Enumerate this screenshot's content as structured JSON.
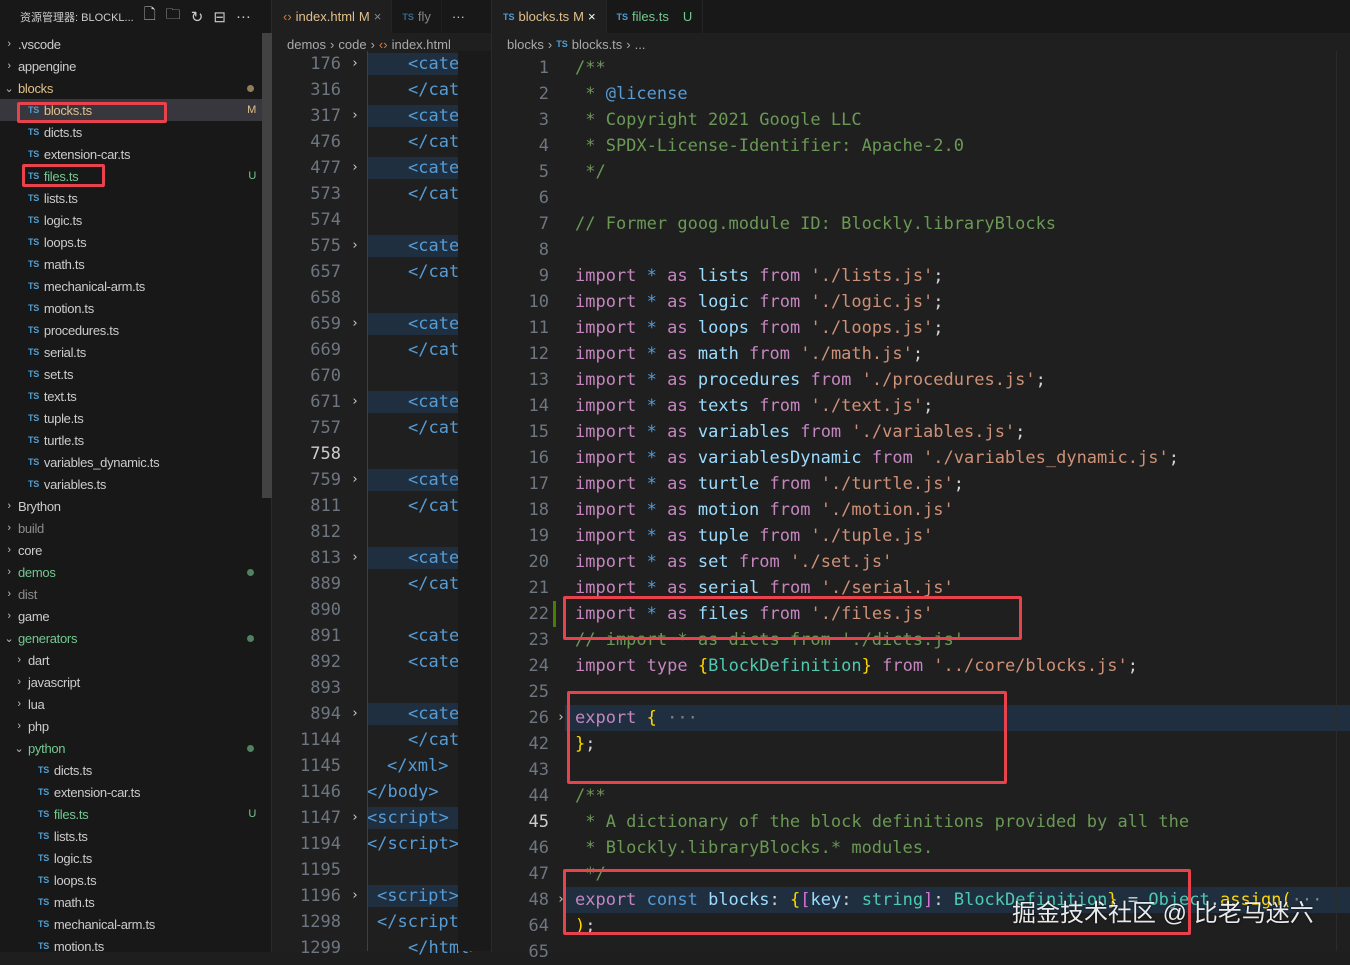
{
  "sidebar": {
    "title": "资源管理器: BLOCKL...",
    "actions": [
      "new-file",
      "new-folder",
      "refresh",
      "collapse-all",
      "more"
    ],
    "items": [
      {
        "label": ".vscode",
        "kind": "folder",
        "depth": 0
      },
      {
        "label": "appengine",
        "kind": "folder",
        "depth": 0
      },
      {
        "label": "blocks",
        "kind": "open",
        "depth": 0,
        "color": "#e2c08d",
        "dot": true
      },
      {
        "label": "blocks.ts",
        "kind": "ts",
        "depth": 1,
        "color": "#e2c08d",
        "badge": "M",
        "selected": true
      },
      {
        "label": "dicts.ts",
        "kind": "ts",
        "depth": 1
      },
      {
        "label": "extension-car.ts",
        "kind": "ts",
        "depth": 1
      },
      {
        "label": "files.ts",
        "kind": "ts",
        "depth": 1,
        "color": "#73c991",
        "badge": "U"
      },
      {
        "label": "lists.ts",
        "kind": "ts",
        "depth": 1
      },
      {
        "label": "logic.ts",
        "kind": "ts",
        "depth": 1
      },
      {
        "label": "loops.ts",
        "kind": "ts",
        "depth": 1
      },
      {
        "label": "math.ts",
        "kind": "ts",
        "depth": 1
      },
      {
        "label": "mechanical-arm.ts",
        "kind": "ts",
        "depth": 1
      },
      {
        "label": "motion.ts",
        "kind": "ts",
        "depth": 1
      },
      {
        "label": "procedures.ts",
        "kind": "ts",
        "depth": 1
      },
      {
        "label": "serial.ts",
        "kind": "ts",
        "depth": 1
      },
      {
        "label": "set.ts",
        "kind": "ts",
        "depth": 1
      },
      {
        "label": "text.ts",
        "kind": "ts",
        "depth": 1
      },
      {
        "label": "tuple.ts",
        "kind": "ts",
        "depth": 1
      },
      {
        "label": "turtle.ts",
        "kind": "ts",
        "depth": 1
      },
      {
        "label": "variables_dynamic.ts",
        "kind": "ts",
        "depth": 1
      },
      {
        "label": "variables.ts",
        "kind": "ts",
        "depth": 1
      },
      {
        "label": "Brython",
        "kind": "folder",
        "depth": 0
      },
      {
        "label": "build",
        "kind": "folder",
        "depth": 0,
        "color": "#8c8c8c"
      },
      {
        "label": "core",
        "kind": "folder",
        "depth": 0
      },
      {
        "label": "demos",
        "kind": "folder",
        "depth": 0,
        "color": "#73c991",
        "dot": true
      },
      {
        "label": "dist",
        "kind": "folder",
        "depth": 0,
        "color": "#8c8c8c"
      },
      {
        "label": "game",
        "kind": "folder",
        "depth": 0
      },
      {
        "label": "generators",
        "kind": "open",
        "depth": 0,
        "color": "#73c991",
        "dot": true
      },
      {
        "label": "dart",
        "kind": "folder",
        "depth": 1
      },
      {
        "label": "javascript",
        "kind": "folder",
        "depth": 1
      },
      {
        "label": "lua",
        "kind": "folder",
        "depth": 1
      },
      {
        "label": "php",
        "kind": "folder",
        "depth": 1
      },
      {
        "label": "python",
        "kind": "open",
        "depth": 1,
        "color": "#73c991",
        "dot": true
      },
      {
        "label": "dicts.ts",
        "kind": "ts",
        "depth": 2
      },
      {
        "label": "extension-car.ts",
        "kind": "ts",
        "depth": 2
      },
      {
        "label": "files.ts",
        "kind": "ts",
        "depth": 2,
        "color": "#73c991",
        "badge": "U"
      },
      {
        "label": "lists.ts",
        "kind": "ts",
        "depth": 2
      },
      {
        "label": "logic.ts",
        "kind": "ts",
        "depth": 2
      },
      {
        "label": "loops.ts",
        "kind": "ts",
        "depth": 2
      },
      {
        "label": "math.ts",
        "kind": "ts",
        "depth": 2
      },
      {
        "label": "mechanical-arm.ts",
        "kind": "ts",
        "depth": 2
      },
      {
        "label": "motion.ts",
        "kind": "ts",
        "depth": 2
      }
    ]
  },
  "editor_left": {
    "tabs": [
      {
        "label": "index.html",
        "badge": "M",
        "icon": "<>",
        "active": true
      },
      {
        "label": "fly",
        "icon": "TS"
      }
    ],
    "more": "···",
    "breadcrumb": [
      "demos",
      "code",
      "index.html"
    ],
    "lines": [
      [
        "176",
        true,
        "<cate",
        true
      ],
      [
        "316",
        false,
        "</cat",
        false
      ],
      [
        "317",
        true,
        "<cate",
        true
      ],
      [
        "476",
        false,
        "</cat",
        false
      ],
      [
        "477",
        true,
        "<cate",
        true
      ],
      [
        "573",
        false,
        "</cat",
        false
      ],
      [
        "574",
        false,
        "",
        false
      ],
      [
        "575",
        true,
        "<cate",
        true
      ],
      [
        "657",
        false,
        "</cat",
        false
      ],
      [
        "658",
        false,
        "",
        false
      ],
      [
        "659",
        true,
        "<cate",
        true
      ],
      [
        "669",
        false,
        "</cat",
        false
      ],
      [
        "670",
        false,
        "",
        false
      ],
      [
        "671",
        true,
        "<cate",
        true
      ],
      [
        "757",
        false,
        "</cat",
        false
      ],
      [
        "758",
        false,
        "",
        false
      ],
      [
        "759",
        true,
        "<cate",
        true
      ],
      [
        "811",
        false,
        "</cat",
        false
      ],
      [
        "812",
        false,
        "",
        false
      ],
      [
        "813",
        true,
        "<cate",
        true
      ],
      [
        "889",
        false,
        "</cat",
        false
      ],
      [
        "890",
        false,
        "",
        false
      ],
      [
        "891",
        false,
        "<cate",
        false
      ],
      [
        "892",
        false,
        "<cate",
        false
      ],
      [
        "893",
        false,
        "",
        false
      ],
      [
        "894",
        true,
        "<cate",
        true
      ],
      [
        "1144",
        false,
        "</cat",
        false
      ],
      [
        "1145",
        false,
        "</xml>",
        false
      ],
      [
        "1146",
        false,
        "</body>",
        false
      ],
      [
        "1147",
        true,
        "<script>",
        true
      ],
      [
        "1194",
        false,
        "</script>",
        false
      ],
      [
        "1195",
        false,
        "",
        false
      ],
      [
        "1196",
        true,
        "<script>",
        true
      ],
      [
        "1298",
        false,
        "</script",
        false
      ],
      [
        "1299",
        false,
        "</html>",
        false
      ]
    ],
    "current_line": "758"
  },
  "editor_right": {
    "tabs": [
      {
        "label": "blocks.ts",
        "badge": "M",
        "icon": "TS",
        "active": true,
        "close": "×"
      },
      {
        "label": "files.ts",
        "badge": "U",
        "icon": "TS"
      }
    ],
    "breadcrumb": [
      "blocks",
      "blocks.ts",
      "..."
    ],
    "current_line": "45",
    "lines": [
      [
        "1",
        [
          [
            "c",
            "/**"
          ]
        ]
      ],
      [
        "2",
        [
          [
            "c",
            " * "
          ],
          [
            "b",
            "@license"
          ]
        ]
      ],
      [
        "3",
        [
          [
            "c",
            " * Copyright 2021 Google LLC"
          ]
        ]
      ],
      [
        "4",
        [
          [
            "c",
            " * SPDX-License-Identifier: Apache-2.0"
          ]
        ]
      ],
      [
        "5",
        [
          [
            "c",
            " */"
          ]
        ]
      ],
      [
        "6",
        []
      ],
      [
        "7",
        [
          [
            "c",
            "// Former goog.module ID: Blockly.libraryBlocks"
          ]
        ]
      ],
      [
        "8",
        []
      ],
      [
        "9",
        [
          [
            "k",
            "import "
          ],
          [
            "b",
            "* "
          ],
          [
            "k",
            "as "
          ],
          [
            "v",
            "lists "
          ],
          [
            "k",
            "from "
          ],
          [
            "s",
            "'./lists.js'"
          ],
          [
            "p",
            ";"
          ]
        ]
      ],
      [
        "10",
        [
          [
            "k",
            "import "
          ],
          [
            "b",
            "* "
          ],
          [
            "k",
            "as "
          ],
          [
            "v",
            "logic "
          ],
          [
            "k",
            "from "
          ],
          [
            "s",
            "'./logic.js'"
          ],
          [
            "p",
            ";"
          ]
        ]
      ],
      [
        "11",
        [
          [
            "k",
            "import "
          ],
          [
            "b",
            "* "
          ],
          [
            "k",
            "as "
          ],
          [
            "v",
            "loops "
          ],
          [
            "k",
            "from "
          ],
          [
            "s",
            "'./loops.js'"
          ],
          [
            "p",
            ";"
          ]
        ]
      ],
      [
        "12",
        [
          [
            "k",
            "import "
          ],
          [
            "b",
            "* "
          ],
          [
            "k",
            "as "
          ],
          [
            "v",
            "math "
          ],
          [
            "k",
            "from "
          ],
          [
            "s",
            "'./math.js'"
          ],
          [
            "p",
            ";"
          ]
        ]
      ],
      [
        "13",
        [
          [
            "k",
            "import "
          ],
          [
            "b",
            "* "
          ],
          [
            "k",
            "as "
          ],
          [
            "v",
            "procedures "
          ],
          [
            "k",
            "from "
          ],
          [
            "s",
            "'./procedures.js'"
          ],
          [
            "p",
            ";"
          ]
        ]
      ],
      [
        "14",
        [
          [
            "k",
            "import "
          ],
          [
            "b",
            "* "
          ],
          [
            "k",
            "as "
          ],
          [
            "v",
            "texts "
          ],
          [
            "k",
            "from "
          ],
          [
            "s",
            "'./text.js'"
          ],
          [
            "p",
            ";"
          ]
        ]
      ],
      [
        "15",
        [
          [
            "k",
            "import "
          ],
          [
            "b",
            "* "
          ],
          [
            "k",
            "as "
          ],
          [
            "v",
            "variables "
          ],
          [
            "k",
            "from "
          ],
          [
            "s",
            "'./variables.js'"
          ],
          [
            "p",
            ";"
          ]
        ]
      ],
      [
        "16",
        [
          [
            "k",
            "import "
          ],
          [
            "b",
            "* "
          ],
          [
            "k",
            "as "
          ],
          [
            "v",
            "variablesDynamic "
          ],
          [
            "k",
            "from "
          ],
          [
            "s",
            "'./variables_dynamic.js'"
          ],
          [
            "p",
            ";"
          ]
        ]
      ],
      [
        "17",
        [
          [
            "k",
            "import "
          ],
          [
            "b",
            "* "
          ],
          [
            "k",
            "as "
          ],
          [
            "v",
            "turtle "
          ],
          [
            "k",
            "from "
          ],
          [
            "s",
            "'./turtle.js'"
          ],
          [
            "p",
            ";"
          ]
        ]
      ],
      [
        "18",
        [
          [
            "k",
            "import "
          ],
          [
            "b",
            "* "
          ],
          [
            "k",
            "as "
          ],
          [
            "v",
            "motion "
          ],
          [
            "k",
            "from "
          ],
          [
            "s",
            "'./motion.js'"
          ]
        ]
      ],
      [
        "19",
        [
          [
            "k",
            "import "
          ],
          [
            "b",
            "* "
          ],
          [
            "k",
            "as "
          ],
          [
            "v",
            "tuple "
          ],
          [
            "k",
            "from "
          ],
          [
            "s",
            "'./tuple.js'"
          ]
        ]
      ],
      [
        "20",
        [
          [
            "k",
            "import "
          ],
          [
            "b",
            "* "
          ],
          [
            "k",
            "as "
          ],
          [
            "v",
            "set "
          ],
          [
            "k",
            "from "
          ],
          [
            "s",
            "'./set.js'"
          ]
        ]
      ],
      [
        "21",
        [
          [
            "k",
            "import "
          ],
          [
            "b",
            "* "
          ],
          [
            "k",
            "as "
          ],
          [
            "v",
            "serial "
          ],
          [
            "k",
            "from "
          ],
          [
            "s",
            "'./serial.js'"
          ]
        ]
      ],
      [
        "22",
        [
          [
            "k",
            "import "
          ],
          [
            "b",
            "* "
          ],
          [
            "k",
            "as "
          ],
          [
            "v",
            "files "
          ],
          [
            "k",
            "from "
          ],
          [
            "s",
            "'./files.js'"
          ]
        ]
      ],
      [
        "23",
        [
          [
            "c",
            "// import * as dicts from './dicts.js'"
          ]
        ]
      ],
      [
        "24",
        [
          [
            "k",
            "import "
          ],
          [
            "k",
            "type "
          ],
          [
            "y",
            "{"
          ],
          [
            "t",
            "BlockDefinition"
          ],
          [
            "y",
            "} "
          ],
          [
            "k",
            "from "
          ],
          [
            "s",
            "'../core/blocks.js'"
          ],
          [
            "p",
            ";"
          ]
        ]
      ],
      [
        "25",
        []
      ],
      [
        "26",
        [
          [
            "k",
            "export "
          ],
          [
            "y",
            "{"
          ],
          [
            "g",
            " ···"
          ]
        ],
        true,
        true
      ],
      [
        "42",
        [
          [
            "y",
            "}"
          ],
          [
            "p",
            ";"
          ]
        ]
      ],
      [
        "43",
        []
      ],
      [
        "44",
        [
          [
            "c",
            "/**"
          ]
        ]
      ],
      [
        "45",
        [
          [
            "c",
            " * A dictionary of the block definitions provided by all the"
          ]
        ]
      ],
      [
        "46",
        [
          [
            "c",
            " * Blockly.libraryBlocks.* modules."
          ]
        ]
      ],
      [
        "47",
        [
          [
            "c",
            " */"
          ]
        ]
      ],
      [
        "48",
        [
          [
            "k",
            "export "
          ],
          [
            "b",
            "const "
          ],
          [
            "v",
            "blocks"
          ],
          [
            "p",
            ": "
          ],
          [
            "y",
            "{"
          ],
          [
            "m",
            "["
          ],
          [
            "v",
            "key"
          ],
          [
            "p",
            ": "
          ],
          [
            "t",
            "string"
          ],
          [
            "m",
            "]"
          ],
          [
            "p",
            ": "
          ],
          [
            "t",
            "BlockDefinition"
          ],
          [
            "y",
            "}"
          ],
          [
            "p",
            " = "
          ],
          [
            "t",
            "Object"
          ],
          [
            "p",
            "."
          ],
          [
            "y",
            "assign("
          ],
          [
            "g",
            "···"
          ]
        ],
        true,
        true
      ],
      [
        "64",
        [
          [
            "y",
            ")"
          ],
          [
            "p",
            ";"
          ]
        ]
      ],
      [
        "65",
        []
      ]
    ]
  },
  "watermark": "掘金技术社区 @ 比老马迷六"
}
